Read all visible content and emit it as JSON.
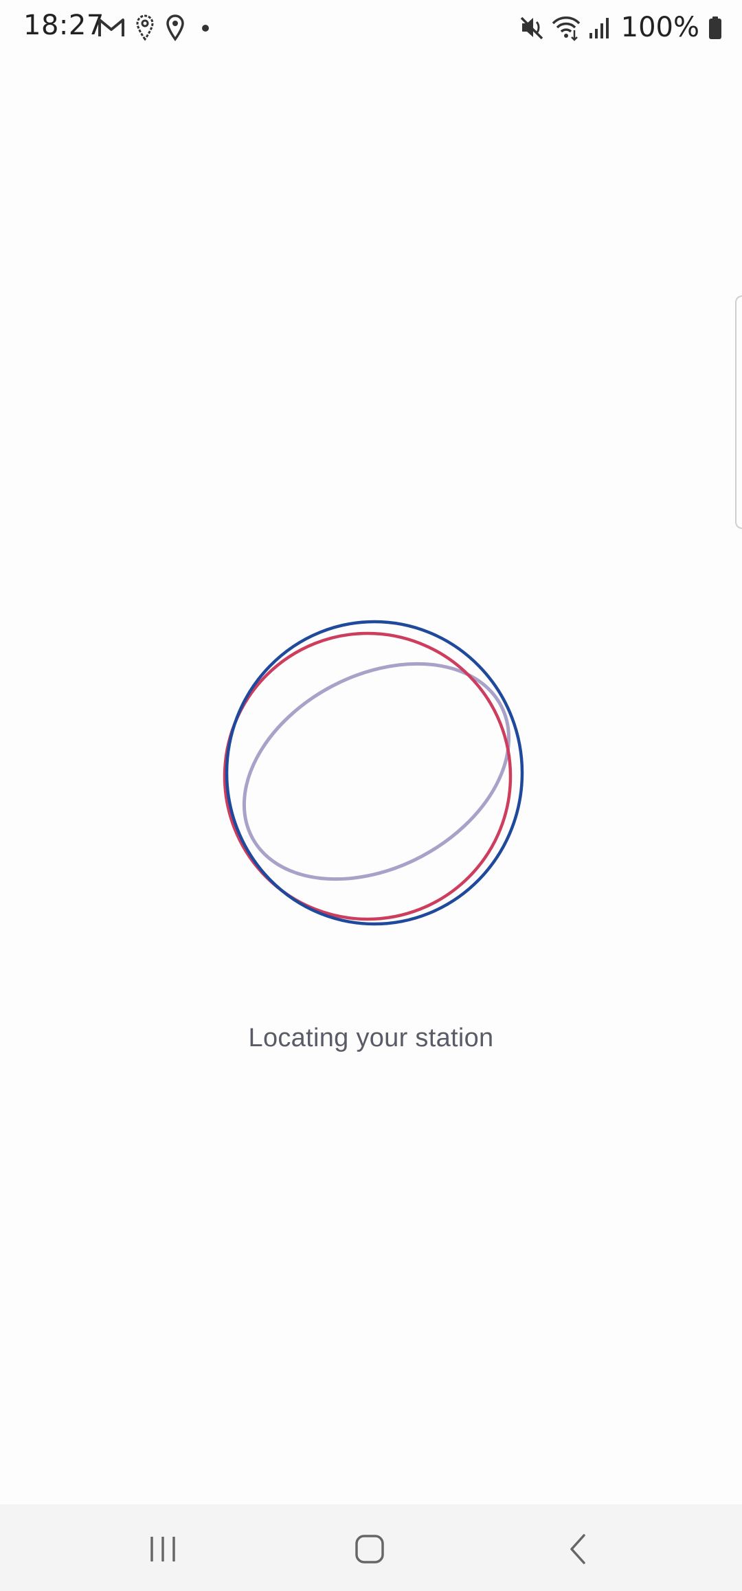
{
  "status_bar": {
    "time": "18:27",
    "battery_percent": "100%",
    "left_icons": [
      "gmail-icon",
      "location-outline-icon",
      "location-icon",
      "dot-icon"
    ],
    "right_icons": [
      "mute-icon",
      "wifi-icon",
      "signal-icon",
      "battery-icon"
    ]
  },
  "main": {
    "loading_text": "Locating your station",
    "loader_colors": {
      "blue": "#1f4a9c",
      "red": "#cc3d5e",
      "lavender": "#a59cc6"
    }
  },
  "nav_bar": {
    "buttons": [
      "recents-icon",
      "home-icon",
      "back-icon"
    ]
  }
}
